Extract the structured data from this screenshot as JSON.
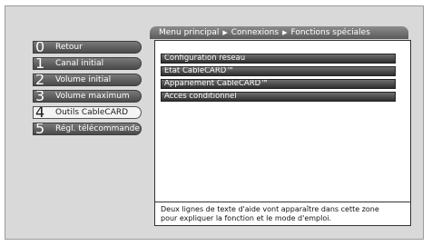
{
  "breadcrumb": {
    "items": [
      "Menu principal",
      "Connexions",
      "Fonctions spéciales"
    ],
    "separator": "▶"
  },
  "sidebar": {
    "items": [
      {
        "number": "0",
        "label": "Retour"
      },
      {
        "number": "1",
        "label": "Canal initial"
      },
      {
        "number": "2",
        "label": "Volume initial"
      },
      {
        "number": "3",
        "label": "Volume maximum"
      },
      {
        "number": "4",
        "label": "Outils CableCARD"
      },
      {
        "number": "5",
        "label": "Régl. télécommande"
      }
    ],
    "selected": "Outils CableCARD"
  },
  "options": [
    "Configuration réseau",
    "Etat CableCARD™",
    "Appariement CableCARD™",
    "Accès conditionnel"
  ],
  "help": {
    "line1": "Deux lignes de texte d'aide vont apparaître dans cette zone",
    "line2": "pour expliquer la fonction et le mode d'emploi."
  }
}
